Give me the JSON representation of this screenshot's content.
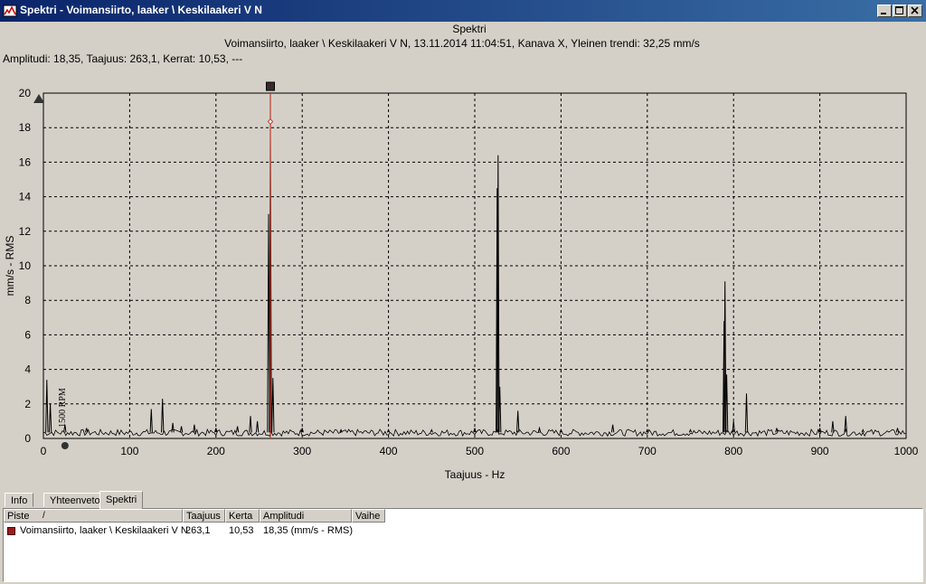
{
  "window": {
    "title": "Spektri - Voimansiirto, laaker \\ Keskilaakeri V N",
    "buttons": [
      "minimize",
      "maximize",
      "close"
    ]
  },
  "chart_header": {
    "title": "Spektri",
    "subtitle": "Voimansiirto, laaker \\ Keskilaakeri V N, 13.11.2014 11:04:51, Kanava X, Yleinen trendi: 32,25 mm/s",
    "cursor_readout": "Amplitudi: 18,35,  Taajuus: 263,1,  Kerrat: 10,53,  ---"
  },
  "chart_data": {
    "type": "line",
    "title": "Spektri",
    "xlabel": "Taajuus - Hz",
    "ylabel": "mm/s - RMS",
    "xlim": [
      0,
      1000
    ],
    "ylim": [
      0,
      20
    ],
    "x_ticks": [
      "0",
      "100",
      "200",
      "300",
      "400",
      "500",
      "600",
      "700",
      "800",
      "900",
      "1000"
    ],
    "y_ticks": [
      "0",
      "2",
      "4",
      "6",
      "8",
      "10",
      "12",
      "14",
      "16",
      "18",
      "20"
    ],
    "grid": true,
    "rpm_annotation": "1500 RPM",
    "rpm_marker_x": 25,
    "cursor": {
      "x": 263.1,
      "y": 18.35
    },
    "noise_floor": 0.35,
    "peaks": [
      {
        "x": 4,
        "y": 3.4
      },
      {
        "x": 8,
        "y": 2.0
      },
      {
        "x": 25,
        "y": 0.8
      },
      {
        "x": 50,
        "y": 0.6
      },
      {
        "x": 125,
        "y": 1.7
      },
      {
        "x": 138,
        "y": 2.3
      },
      {
        "x": 150,
        "y": 0.9
      },
      {
        "x": 160,
        "y": 0.7
      },
      {
        "x": 175,
        "y": 0.8
      },
      {
        "x": 200,
        "y": 0.6
      },
      {
        "x": 225,
        "y": 0.7
      },
      {
        "x": 240,
        "y": 1.3
      },
      {
        "x": 248,
        "y": 1.0
      },
      {
        "x": 261,
        "y": 13.0
      },
      {
        "x": 263.1,
        "y": 17.6
      },
      {
        "x": 266,
        "y": 3.5
      },
      {
        "x": 300,
        "y": 0.6
      },
      {
        "x": 345,
        "y": 0.5
      },
      {
        "x": 400,
        "y": 0.5
      },
      {
        "x": 450,
        "y": 0.5
      },
      {
        "x": 500,
        "y": 0.6
      },
      {
        "x": 526,
        "y": 14.5
      },
      {
        "x": 527,
        "y": 16.4
      },
      {
        "x": 529,
        "y": 3.0
      },
      {
        "x": 550,
        "y": 1.6
      },
      {
        "x": 575,
        "y": 0.6
      },
      {
        "x": 600,
        "y": 0.5
      },
      {
        "x": 660,
        "y": 0.8
      },
      {
        "x": 700,
        "y": 0.5
      },
      {
        "x": 750,
        "y": 0.5
      },
      {
        "x": 789,
        "y": 6.8
      },
      {
        "x": 790,
        "y": 9.1
      },
      {
        "x": 792,
        "y": 3.7
      },
      {
        "x": 800,
        "y": 1.0
      },
      {
        "x": 815,
        "y": 2.6
      },
      {
        "x": 850,
        "y": 0.6
      },
      {
        "x": 900,
        "y": 0.6
      },
      {
        "x": 915,
        "y": 1.0
      },
      {
        "x": 930,
        "y": 1.3
      },
      {
        "x": 950,
        "y": 0.5
      },
      {
        "x": 990,
        "y": 0.6
      }
    ]
  },
  "tabs": [
    {
      "label": "Info",
      "active": false
    },
    {
      "label": "Yhteenveto",
      "active": false
    },
    {
      "label": "Spektri",
      "active": true
    }
  ],
  "table": {
    "columns": [
      "Piste",
      "Taajuus",
      "Kerta",
      "Amplitudi",
      "Vaihe"
    ],
    "sort_indicator": "/",
    "rows": [
      {
        "marker_color": "#9b1c1c",
        "piste": "Voimansiirto, laaker \\ Keskilaakeri V N",
        "taajuus": "263,1",
        "kerta": "10,53",
        "amplitudi": "18,35 (mm/s - RMS)",
        "vaihe": ""
      }
    ]
  },
  "colors": {
    "titlebar": "#0a246a",
    "cursor_line": "#c0392b",
    "spectrum": "#000000",
    "grid": "#000000"
  }
}
